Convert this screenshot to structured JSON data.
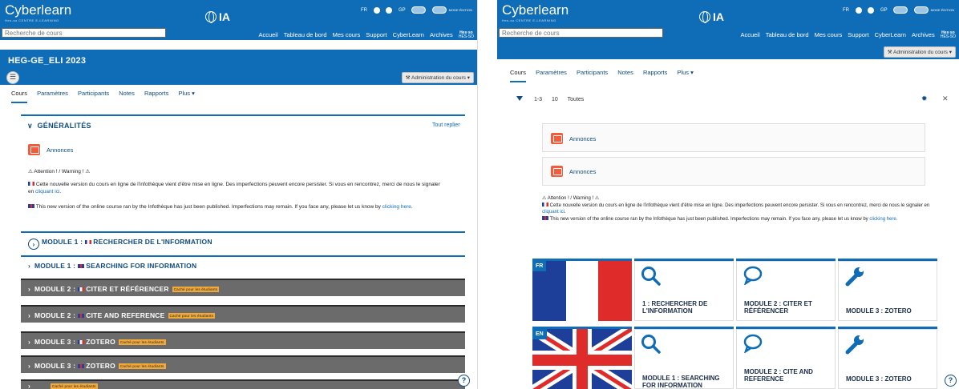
{
  "brand": {
    "name": "Cyberlearn",
    "sub": "Hes-so CENTRE E-LEARNING",
    "ia": "IA"
  },
  "search": {
    "placeholder": "Recherche de cours"
  },
  "nav": [
    "Accueil",
    "Tableau de bord",
    "Mes cours",
    "Support",
    "CyberLearn",
    "Archives"
  ],
  "nav_stacked": {
    "l1": "Hes·so",
    "l2": "HES-SO"
  },
  "top_icons": {
    "lang": "FR",
    "user": "GP",
    "toggle_label": "MODE ÉDITION"
  },
  "course": {
    "title": "HEG-GE_ELI 2023",
    "admin": "Administration du cours"
  },
  "tabs": [
    "Cours",
    "Paramètres",
    "Participants",
    "Notes",
    "Rapports",
    "Plus"
  ],
  "section": {
    "title": "GÉNÉRALITÉS",
    "collapse": "Tout replier"
  },
  "announce": "Annonces",
  "warning": "⚠ Attention ! / Warning ! ⚠",
  "fr_text": "Cette nouvelle version du cours en ligne de l'infothèque vient d'être mise en ligne. Des imperfections peuvent encore persister. Si vous en rencontrez, merci de nous le signaler en",
  "fr_link": "cliquant ici",
  "en_text": "This new version of the online course ran by the Infothèque has just been published. Imperfections may remain. If you face any, please let us know by",
  "en_link": "clicking here",
  "badge": "Caché pour les étudiants",
  "modules": [
    {
      "label": "MODULE 1 :",
      "title": "RECHERCHER DE L'INFORMATION",
      "flag": "fr"
    },
    {
      "label": "MODULE 1 :",
      "title": "SEARCHING FOR INFORMATION",
      "flag": "uk"
    },
    {
      "label": "MODULE 2 :",
      "title": "CITER ET RÉFÉRENCER",
      "flag": "fr"
    },
    {
      "label": "MODULE 2 :",
      "title": "CITE AND REFERENCE",
      "flag": "uk"
    },
    {
      "label": "MODULE 3 :",
      "title": "ZOTERO",
      "flag": "fr"
    },
    {
      "label": "MODULE 3 :",
      "title": "ZOTERO",
      "flag": "uk"
    }
  ],
  "filter": {
    "range": "1-3",
    "count": "10",
    "all": "Toutes"
  },
  "tiles": {
    "fr_code": "FR",
    "en_code": "EN",
    "t1": "1 : RECHERCHER DE L'INFORMATION",
    "t2": "MODULE 2 : CITER ET RÉFÉRENCER",
    "t3": "MODULE 3 : ZOTERO",
    "t4": "MODULE 1 : SEARCHING FOR INFORMATION",
    "t5": "MODULE 2 : CITE AND REFERENCE",
    "t6": "MODULE 3 : ZOTERO"
  },
  "help": "?",
  "colors": {
    "primary": "#0f6cb6",
    "hidden_row": "#6b6b6b",
    "badge": "#f0a93b",
    "activity_icon": "#f25c3c"
  }
}
